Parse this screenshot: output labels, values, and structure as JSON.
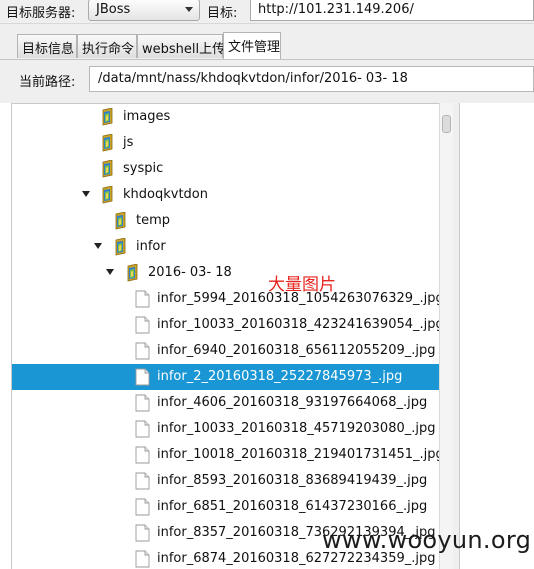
{
  "topbar": {
    "server_label": "目标服务器:",
    "server_value": "JBoss",
    "target_label": "目标:",
    "target_value": "http://101.231.149.206/"
  },
  "tabs": [
    {
      "label": "目标信息"
    },
    {
      "label": "执行命令"
    },
    {
      "label": "webshell上传"
    },
    {
      "label": "文件管理",
      "active": true
    }
  ],
  "path": {
    "label": "当前路径:",
    "value": "/data/mnt/nass/khdoqkvtdon/infor/2016- 03- 18"
  },
  "tree": {
    "items": [
      {
        "label": "images",
        "kind": "folder",
        "depth": 0
      },
      {
        "label": "js",
        "kind": "folder",
        "depth": 0
      },
      {
        "label": "syspic",
        "kind": "folder",
        "depth": 0
      },
      {
        "label": "khdoqkvtdon",
        "kind": "folder",
        "depth": 0,
        "expanded": true
      },
      {
        "label": "temp",
        "kind": "folder",
        "depth": 1
      },
      {
        "label": "infor",
        "kind": "folder",
        "depth": 1,
        "expanded": true
      },
      {
        "label": "2016- 03- 18",
        "kind": "folder",
        "depth": 2,
        "expanded": true
      },
      {
        "label": "infor_5994_20160318_1054263076329_.jpg",
        "kind": "file",
        "depth": 3
      },
      {
        "label": "infor_10033_20160318_423241639054_.jpg",
        "kind": "file",
        "depth": 3
      },
      {
        "label": "infor_6940_20160318_656112055209_.jpg",
        "kind": "file",
        "depth": 3
      },
      {
        "label": "infor_2_20160318_25227845973_.jpg",
        "kind": "file",
        "depth": 3,
        "selected": true
      },
      {
        "label": "infor_4606_20160318_93197664068_.jpg",
        "kind": "file",
        "depth": 3
      },
      {
        "label": "infor_10033_20160318_45719203080_.jpg",
        "kind": "file",
        "depth": 3
      },
      {
        "label": "infor_10018_20160318_219401731451_.jpg",
        "kind": "file",
        "depth": 3
      },
      {
        "label": "infor_8593_20160318_83689419439_.jpg",
        "kind": "file",
        "depth": 3
      },
      {
        "label": "infor_6851_20160318_61437230166_.jpg",
        "kind": "file",
        "depth": 3
      },
      {
        "label": "infor_8357_20160318_736292139394_.jpg",
        "kind": "file",
        "depth": 3
      },
      {
        "label": "infor_6874_20160318_627272234359_.jpg",
        "kind": "file",
        "depth": 3
      }
    ]
  },
  "annotation": "大量图片",
  "watermark": "www.wooyun.org",
  "colors": {
    "selection": "#1a96d4",
    "annotation": "#e8261f"
  }
}
